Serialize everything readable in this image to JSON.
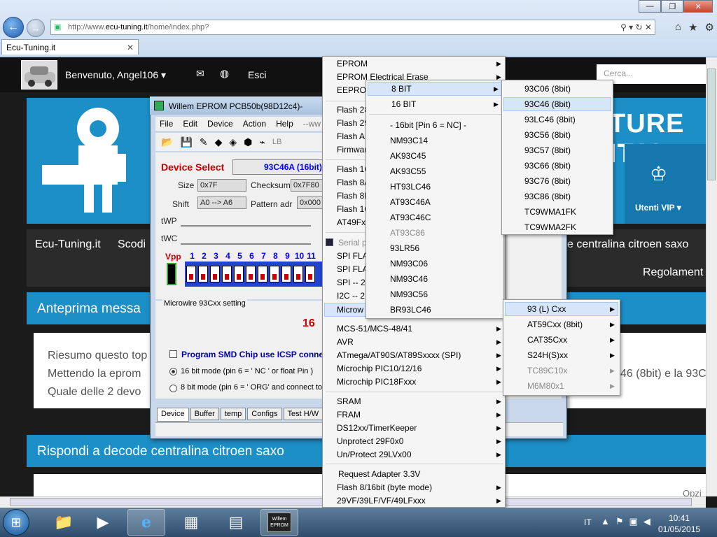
{
  "browser": {
    "url_prefix": "http://www.",
    "url_domain": "ecu-tuning.it",
    "url_suffix": "/home/index.php?",
    "tab_title": "Ecu-Tuning.it",
    "addr_icons": "⚲ ▾ ↻ ✕",
    "right_icons": [
      "⌂",
      "★",
      "⚙"
    ]
  },
  "site": {
    "welcome": "Benvenuto, Angel106 ▾",
    "esci": "Esci",
    "search_placeholder": "Cerca...",
    "banner_text": "TURE ITAL",
    "vip_label": "Utenti VIP ▾",
    "breadcrumb": [
      "Ecu-Tuning.it",
      "Scodi"
    ],
    "breadcrumb_title": "e centralina citroen saxo",
    "regolamento": "Regolament",
    "preview_label": "Anteprima messa",
    "post_lines": [
      "Riesumo questo top",
      "Mettendo la eprom",
      "Quale delle 2 devo"
    ],
    "post_right": "46 (8bit) e la 93C",
    "reply_label": "Rispondi a decode centralina citroen saxo",
    "opzioni": "Opzi"
  },
  "willem": {
    "title": "Willem EPROM PCB50b(98D12c4)-",
    "menu": [
      "File",
      "Edit",
      "Device",
      "Action",
      "Help",
      "--ww"
    ],
    "toolbar_lb": "LB",
    "device_select_label": "Device Select",
    "device_select_value": "93C46A (16bit)",
    "size_label": "Size",
    "size_value": "0x7F",
    "checksum_label": "Checksum",
    "checksum_value": "0x7F80",
    "shift_label": "Shift",
    "shift_value": "A0 --> A6",
    "pattern_label": "Pattern adr",
    "pattern_value": "0x000",
    "twp_label": "tWP",
    "twc_label": "tWC",
    "vpp_label": "Vpp",
    "dip_numbers": [
      "1",
      "2",
      "3",
      "4",
      "5",
      "6",
      "7",
      "8",
      "9",
      "10",
      "11"
    ],
    "mw_legend": "Microwire 93Cxx setting",
    "mw_16": "16",
    "icsp_label": "Program SMD Chip use ICSP conne",
    "radio16_label": "16 bit mode (pin 6 = ' NC ' or float Pin )",
    "radio8_label": "8 bit mode (pin 6 = ' ORG' and  connect to",
    "tabs": [
      "Device",
      "Buffer",
      "temp",
      "Configs",
      "Test H/W"
    ]
  },
  "menu1": {
    "items": [
      {
        "label": "EPROM",
        "arrow": true
      },
      {
        "label": "EPROM Electrical Erase",
        "arrow": true
      },
      {
        "label": "EEPROM",
        "arrow": true
      },
      {
        "label": "Flash 28",
        "arrow": false
      },
      {
        "label": "Flash 29",
        "arrow": false
      },
      {
        "label": "Flash  A",
        "arrow": false
      },
      {
        "label": "Firmwar",
        "arrow": false
      },
      {
        "label": "Flash 16",
        "arrow": false
      },
      {
        "label": "Flash  8/",
        "arrow": false
      },
      {
        "label": "Flash 8b",
        "arrow": false
      },
      {
        "label": "Flash 16",
        "arrow": false
      },
      {
        "label": "AT49Fx",
        "arrow": false
      },
      {
        "label": "Serial p",
        "arrow": false
      },
      {
        "label": "SPI FLAS",
        "arrow": false
      },
      {
        "label": "SPI FLAS",
        "arrow": false
      },
      {
        "label": "SPI -- 25",
        "arrow": false
      },
      {
        "label": "I2C -- 2",
        "arrow": false
      },
      {
        "label": "Microw",
        "arrow": false
      },
      {
        "label": "MCS-51/MCS-48/41",
        "arrow": true
      },
      {
        "label": "AVR",
        "arrow": true
      },
      {
        "label": "ATmega/AT90S/AT89Sxxxx (SPI)",
        "arrow": true
      },
      {
        "label": "Microchip PIC10/12/16",
        "arrow": true
      },
      {
        "label": "Microchip PIC18Fxxx",
        "arrow": true
      },
      {
        "label": "SRAM",
        "arrow": true
      },
      {
        "label": "FRAM",
        "arrow": true
      },
      {
        "label": "DS12xx/TimerKeeper",
        "arrow": true
      },
      {
        "label": "Unprotect 29F0x0",
        "arrow": true
      },
      {
        "label": "Un/Protect 29LVx00",
        "arrow": true
      },
      {
        "label": "Request Adapter 3.3V",
        "arrow": false
      },
      {
        "label": "Flash 8/16bit (byte mode)",
        "arrow": true
      },
      {
        "label": "29VF/39LF/VF/49LFxxx",
        "arrow": true
      }
    ]
  },
  "menu2": {
    "items": [
      {
        "label": "8  BIT",
        "arrow": true
      },
      {
        "label": "16 BIT",
        "arrow": true
      },
      {
        "label": "- 16bit [Pin 6 = NC] -",
        "arrow": false
      },
      {
        "label": "NM93C14",
        "arrow": false
      },
      {
        "label": "AK93C45",
        "arrow": false
      },
      {
        "label": "AK93C55",
        "arrow": false
      },
      {
        "label": "HT93LC46",
        "arrow": false
      },
      {
        "label": "AT93C46A",
        "arrow": false
      },
      {
        "label": "AT93C46C",
        "arrow": false
      },
      {
        "label": "AT93C86",
        "arrow": false
      },
      {
        "label": "93LR56",
        "arrow": false
      },
      {
        "label": "NM93C06",
        "arrow": false
      },
      {
        "label": "NM93C46",
        "arrow": false
      },
      {
        "label": "NM93C56",
        "arrow": false
      },
      {
        "label": "BR93LC46",
        "arrow": false
      }
    ]
  },
  "menu3": {
    "items": [
      "93C06 (8bit)",
      "93C46 (8bit)",
      "93LC46 (8bit)",
      "93C56 (8bit)",
      "93C57 (8bit)",
      "93C66 (8bit)",
      "93C76 (8bit)",
      "93C86 (8bit)",
      "TC9WMA1FK",
      "TC9WMA2FK"
    ]
  },
  "menu4": {
    "items": [
      "93 (L) Cxx",
      "AT59Cxx  (8bit)",
      "CAT35Cxx",
      "S24H(S)xx",
      "TC89C10x",
      "M6M80x1"
    ]
  },
  "taskbar": {
    "lang": "IT",
    "time": "10:41",
    "date": "01/05/2015",
    "willem_label": "Willem EPROM"
  },
  "colors": {
    "site_blue": "#1c8fc7",
    "menu_highlight": "#d6e6f8",
    "device_select_red": "#cc0000"
  }
}
